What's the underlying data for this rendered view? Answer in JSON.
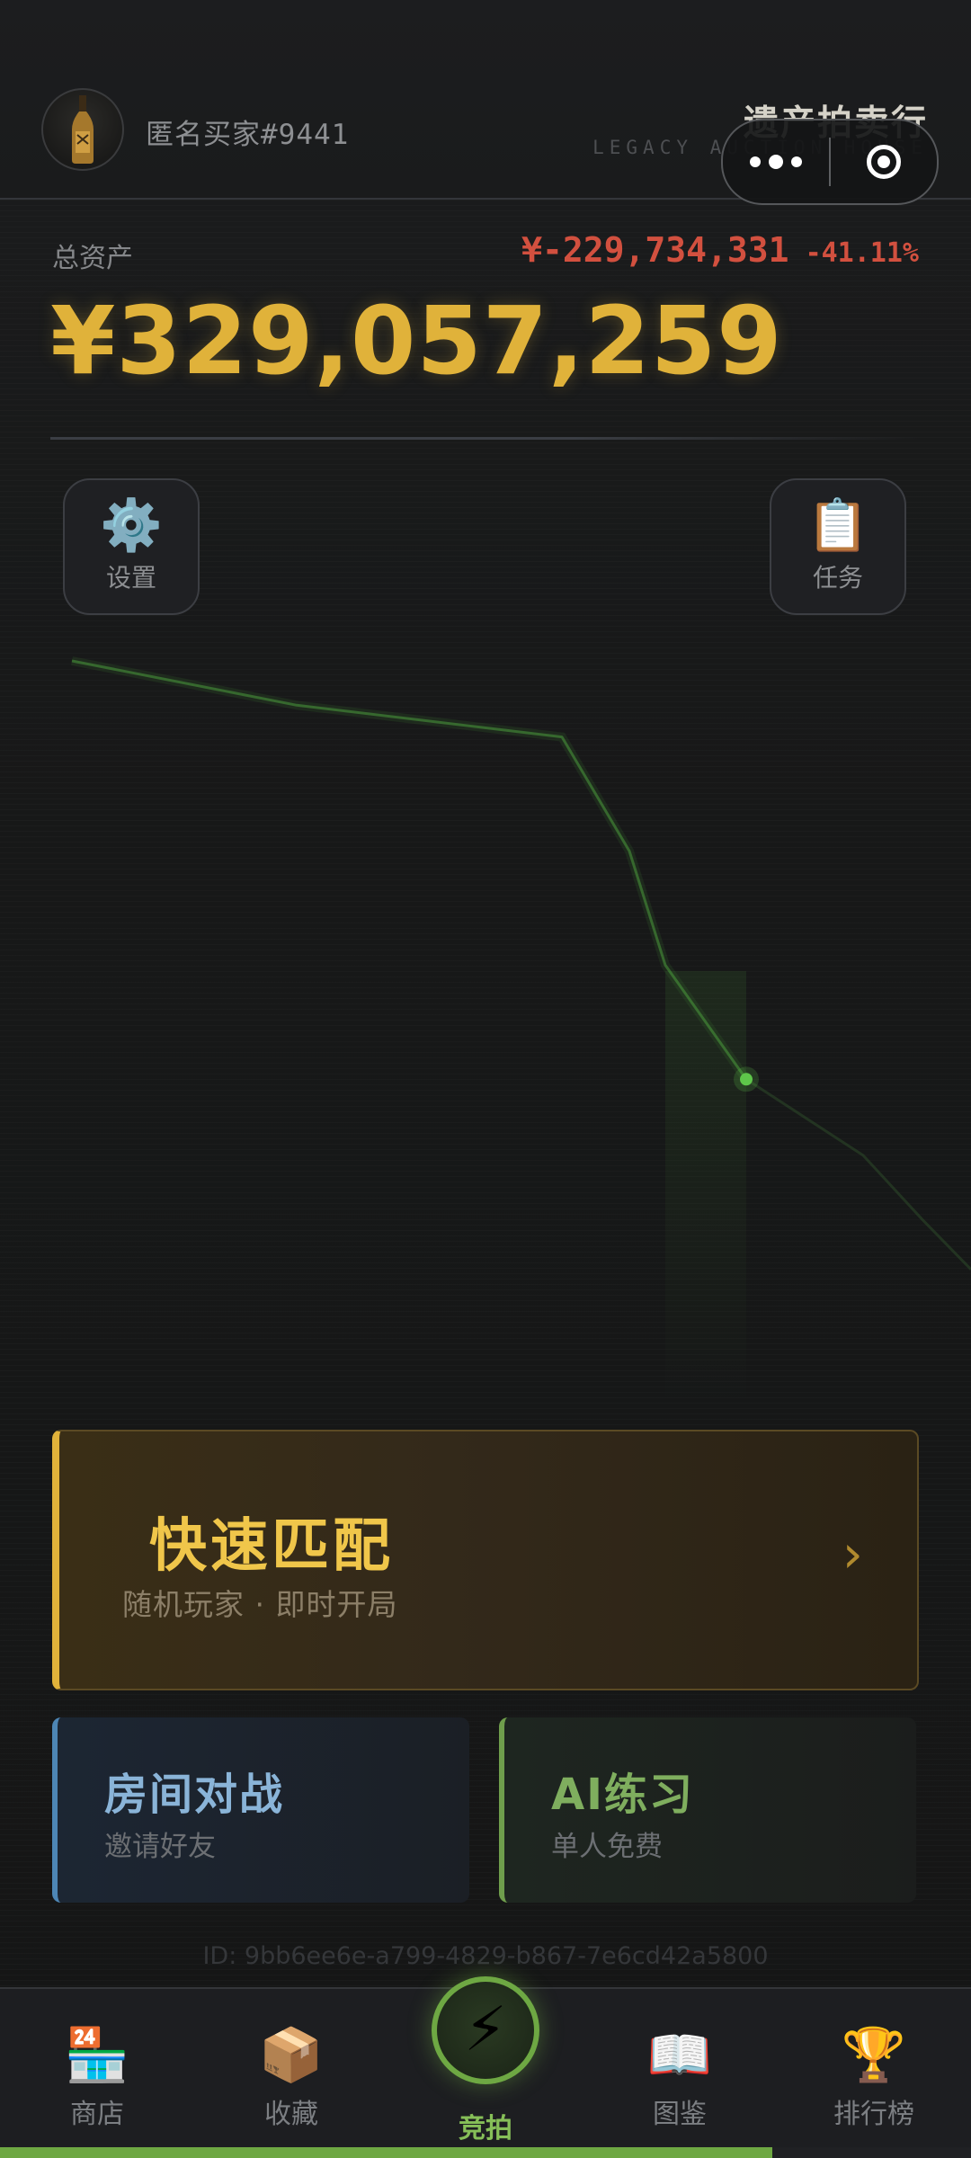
{
  "header": {
    "username": "匿名买家#9441",
    "brand_title": "遗产拍卖行",
    "brand_subtitle": "LEGACY AUCTION HOUSE",
    "avatar_icon": "wine-bottle-icon"
  },
  "assets": {
    "label": "总资产",
    "total": "¥329,057,259",
    "change_amount": "¥-229,734,331",
    "change_percent": "-41.11%",
    "color_total": "#e0b23a",
    "color_negative": "#d2503f"
  },
  "tools": {
    "settings": {
      "label": "设置",
      "icon": "⚙️"
    },
    "tasks": {
      "label": "任务",
      "icon": "📋"
    }
  },
  "chart_data": {
    "type": "line",
    "title": "",
    "xlabel": "",
    "ylabel": "",
    "grid": false,
    "series": [
      {
        "values": [
          100,
          93,
          88,
          70,
          52,
          34
        ]
      },
      {
        "values": [
          34,
          22,
          12,
          4
        ]
      }
    ],
    "colors": [
      "#4a9a3c",
      "#2e4a2a"
    ]
  },
  "quick_match": {
    "title": "快速匹配",
    "subtitle": "随机玩家 · 即时开局",
    "arrow": "›"
  },
  "modes": {
    "room": {
      "title": "房间对战",
      "subtitle": "邀请好友"
    },
    "ai": {
      "title": "AI练习",
      "subtitle": "单人免费"
    }
  },
  "user_id": "ID: 9bb6ee6e-a799-4829-b867-7e6cd42a5800",
  "nav": {
    "shop": {
      "label": "商店",
      "icon": "🏪"
    },
    "collection": {
      "label": "收藏",
      "icon": "📦"
    },
    "auction": {
      "label": "竞拍",
      "icon": "⚡"
    },
    "atlas": {
      "label": "图鉴",
      "icon": "📖"
    },
    "rank": {
      "label": "排行榜",
      "icon": "🏆"
    },
    "active_color": "#86bf58"
  },
  "progress": {
    "value": 0.795
  }
}
